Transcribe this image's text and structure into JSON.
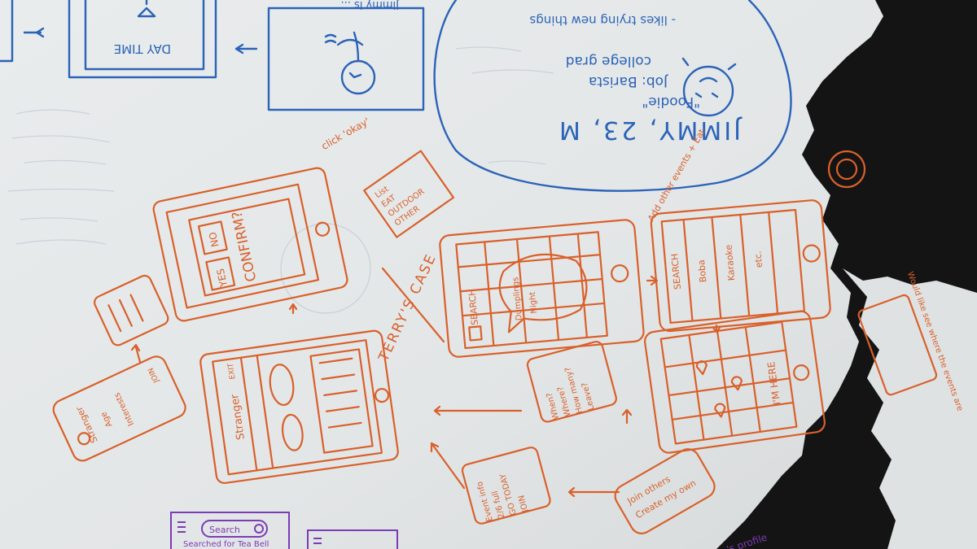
{
  "persona": {
    "name_line": "JIMMY, 23, M",
    "nickname": "\"Foodie\"",
    "job": "Job: Barista",
    "education": "college grad",
    "trait": "- likes trying new things",
    "top_caption": "Jimmy is ..."
  },
  "storyboard": {
    "day_time": "DAY TIME",
    "click_okay": "click 'okay'",
    "list_types": [
      "List",
      "EAT",
      "OUTDOOR",
      "OTHER"
    ],
    "confirm": {
      "title": "CONFIRM?",
      "yes": "YES",
      "no": "NO"
    },
    "case_label": "TERRY'S CASE",
    "search_screen_1": {
      "search": "SEARCH",
      "bubble_line1": "Dumplings",
      "bubble_line2": "Night"
    },
    "search_screen_2": {
      "search": "SEARCH",
      "items": [
        "Boba",
        "Karaoke",
        "etc."
      ],
      "side_note": "Add other events + Eat"
    },
    "map_screen": {
      "button": "I'M HERE"
    },
    "stranger_chat": {
      "name": "Stranger",
      "exit": "EXIT"
    },
    "profile_card": {
      "name": "Stranger",
      "age": "Age",
      "interests": "Interests",
      "join": "JOIN"
    },
    "details_card": {
      "lines": [
        "When?",
        "Where?",
        "How many?",
        "Leave?"
      ]
    },
    "event_card": {
      "lines": [
        "Event info",
        "2/6 full",
        "GO TODAY",
        "JOIN"
      ]
    },
    "join_card": {
      "lines": [
        "Join others",
        "Create my own"
      ]
    },
    "right_note": "Would like see where the events are",
    "bottom_right": "...'s profile"
  },
  "bottom_sketch": {
    "search": "Search",
    "caption": "Searched for Tea Bell"
  }
}
